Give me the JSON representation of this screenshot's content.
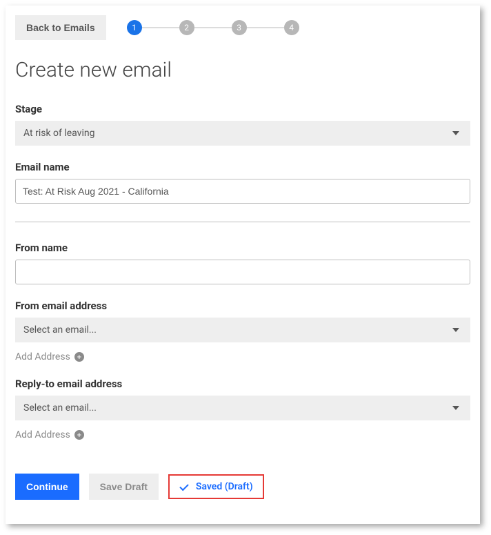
{
  "topbar": {
    "back_label": "Back to Emails",
    "steps": [
      "1",
      "2",
      "3",
      "4"
    ],
    "active_step_index": 0
  },
  "page_title": "Create new email",
  "stage": {
    "label": "Stage",
    "selected": "At risk of leaving"
  },
  "email_name": {
    "label": "Email name",
    "value": "Test: At Risk Aug 2021 - California"
  },
  "from_name": {
    "label": "From name",
    "value": ""
  },
  "from_email": {
    "label": "From email address",
    "selected": "Select an email...",
    "add_link": "Add Address"
  },
  "reply_to": {
    "label": "Reply-to email address",
    "selected": "Select an email...",
    "add_link": "Add Address"
  },
  "footer": {
    "continue": "Continue",
    "save_draft": "Save Draft",
    "saved_badge": "Saved (Draft)"
  }
}
